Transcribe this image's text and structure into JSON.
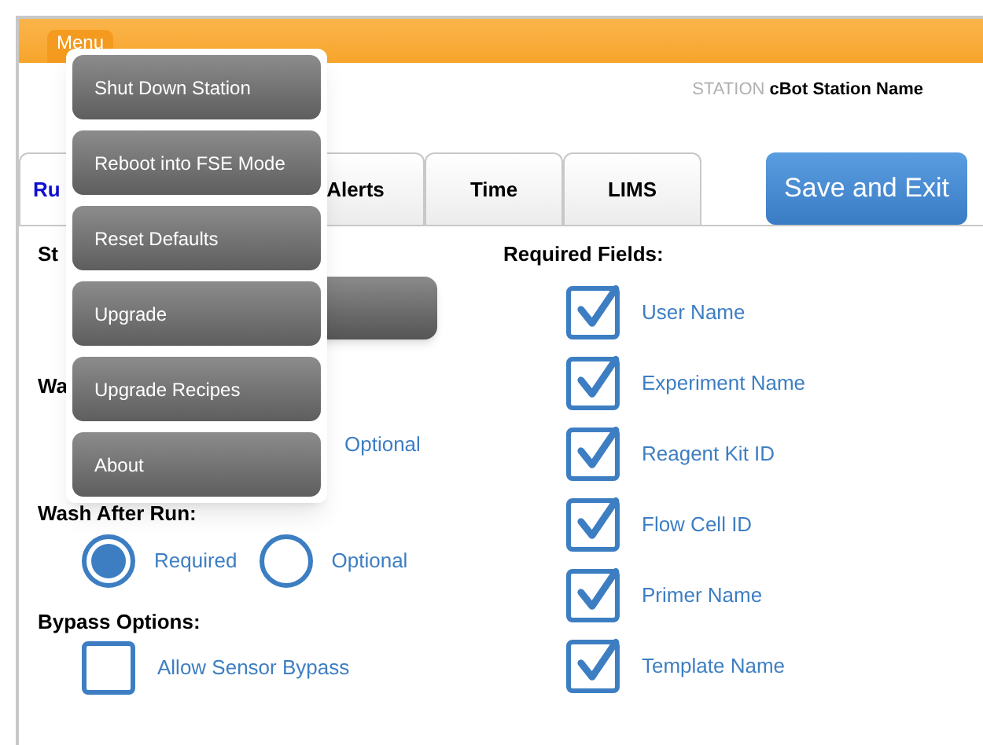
{
  "menu_tab": "Menu",
  "station": {
    "label": "STATION",
    "name": "cBot Station Name"
  },
  "tabs": [
    {
      "label": "Ru",
      "selected": true
    },
    {
      "label": "Alerts",
      "selected": false
    },
    {
      "label": "Time",
      "selected": false
    },
    {
      "label": "LIMS",
      "selected": false
    }
  ],
  "save_button": "Save and Exit",
  "left": {
    "heading_1": "St",
    "heading_2": "Wa",
    "wash_before_option": "Optional",
    "wash_after": {
      "title": "Wash After Run:",
      "options": [
        {
          "label": "Required",
          "selected": true
        },
        {
          "label": "Optional",
          "selected": false
        }
      ]
    },
    "bypass": {
      "title": "Bypass Options:",
      "options": [
        {
          "label": "Allow Sensor Bypass",
          "checked": false
        }
      ]
    }
  },
  "required_fields": {
    "title": "Required Fields:",
    "items": [
      {
        "label": "User Name",
        "checked": true
      },
      {
        "label": "Experiment Name",
        "checked": true
      },
      {
        "label": "Reagent Kit ID",
        "checked": true
      },
      {
        "label": "Flow Cell ID",
        "checked": true
      },
      {
        "label": "Primer Name",
        "checked": true
      },
      {
        "label": "Template Name",
        "checked": true
      }
    ]
  },
  "menu": {
    "items": [
      "Shut Down Station",
      "Reboot into FSE Mode",
      "Reset Defaults",
      "Upgrade",
      "Upgrade Recipes",
      "About"
    ]
  }
}
